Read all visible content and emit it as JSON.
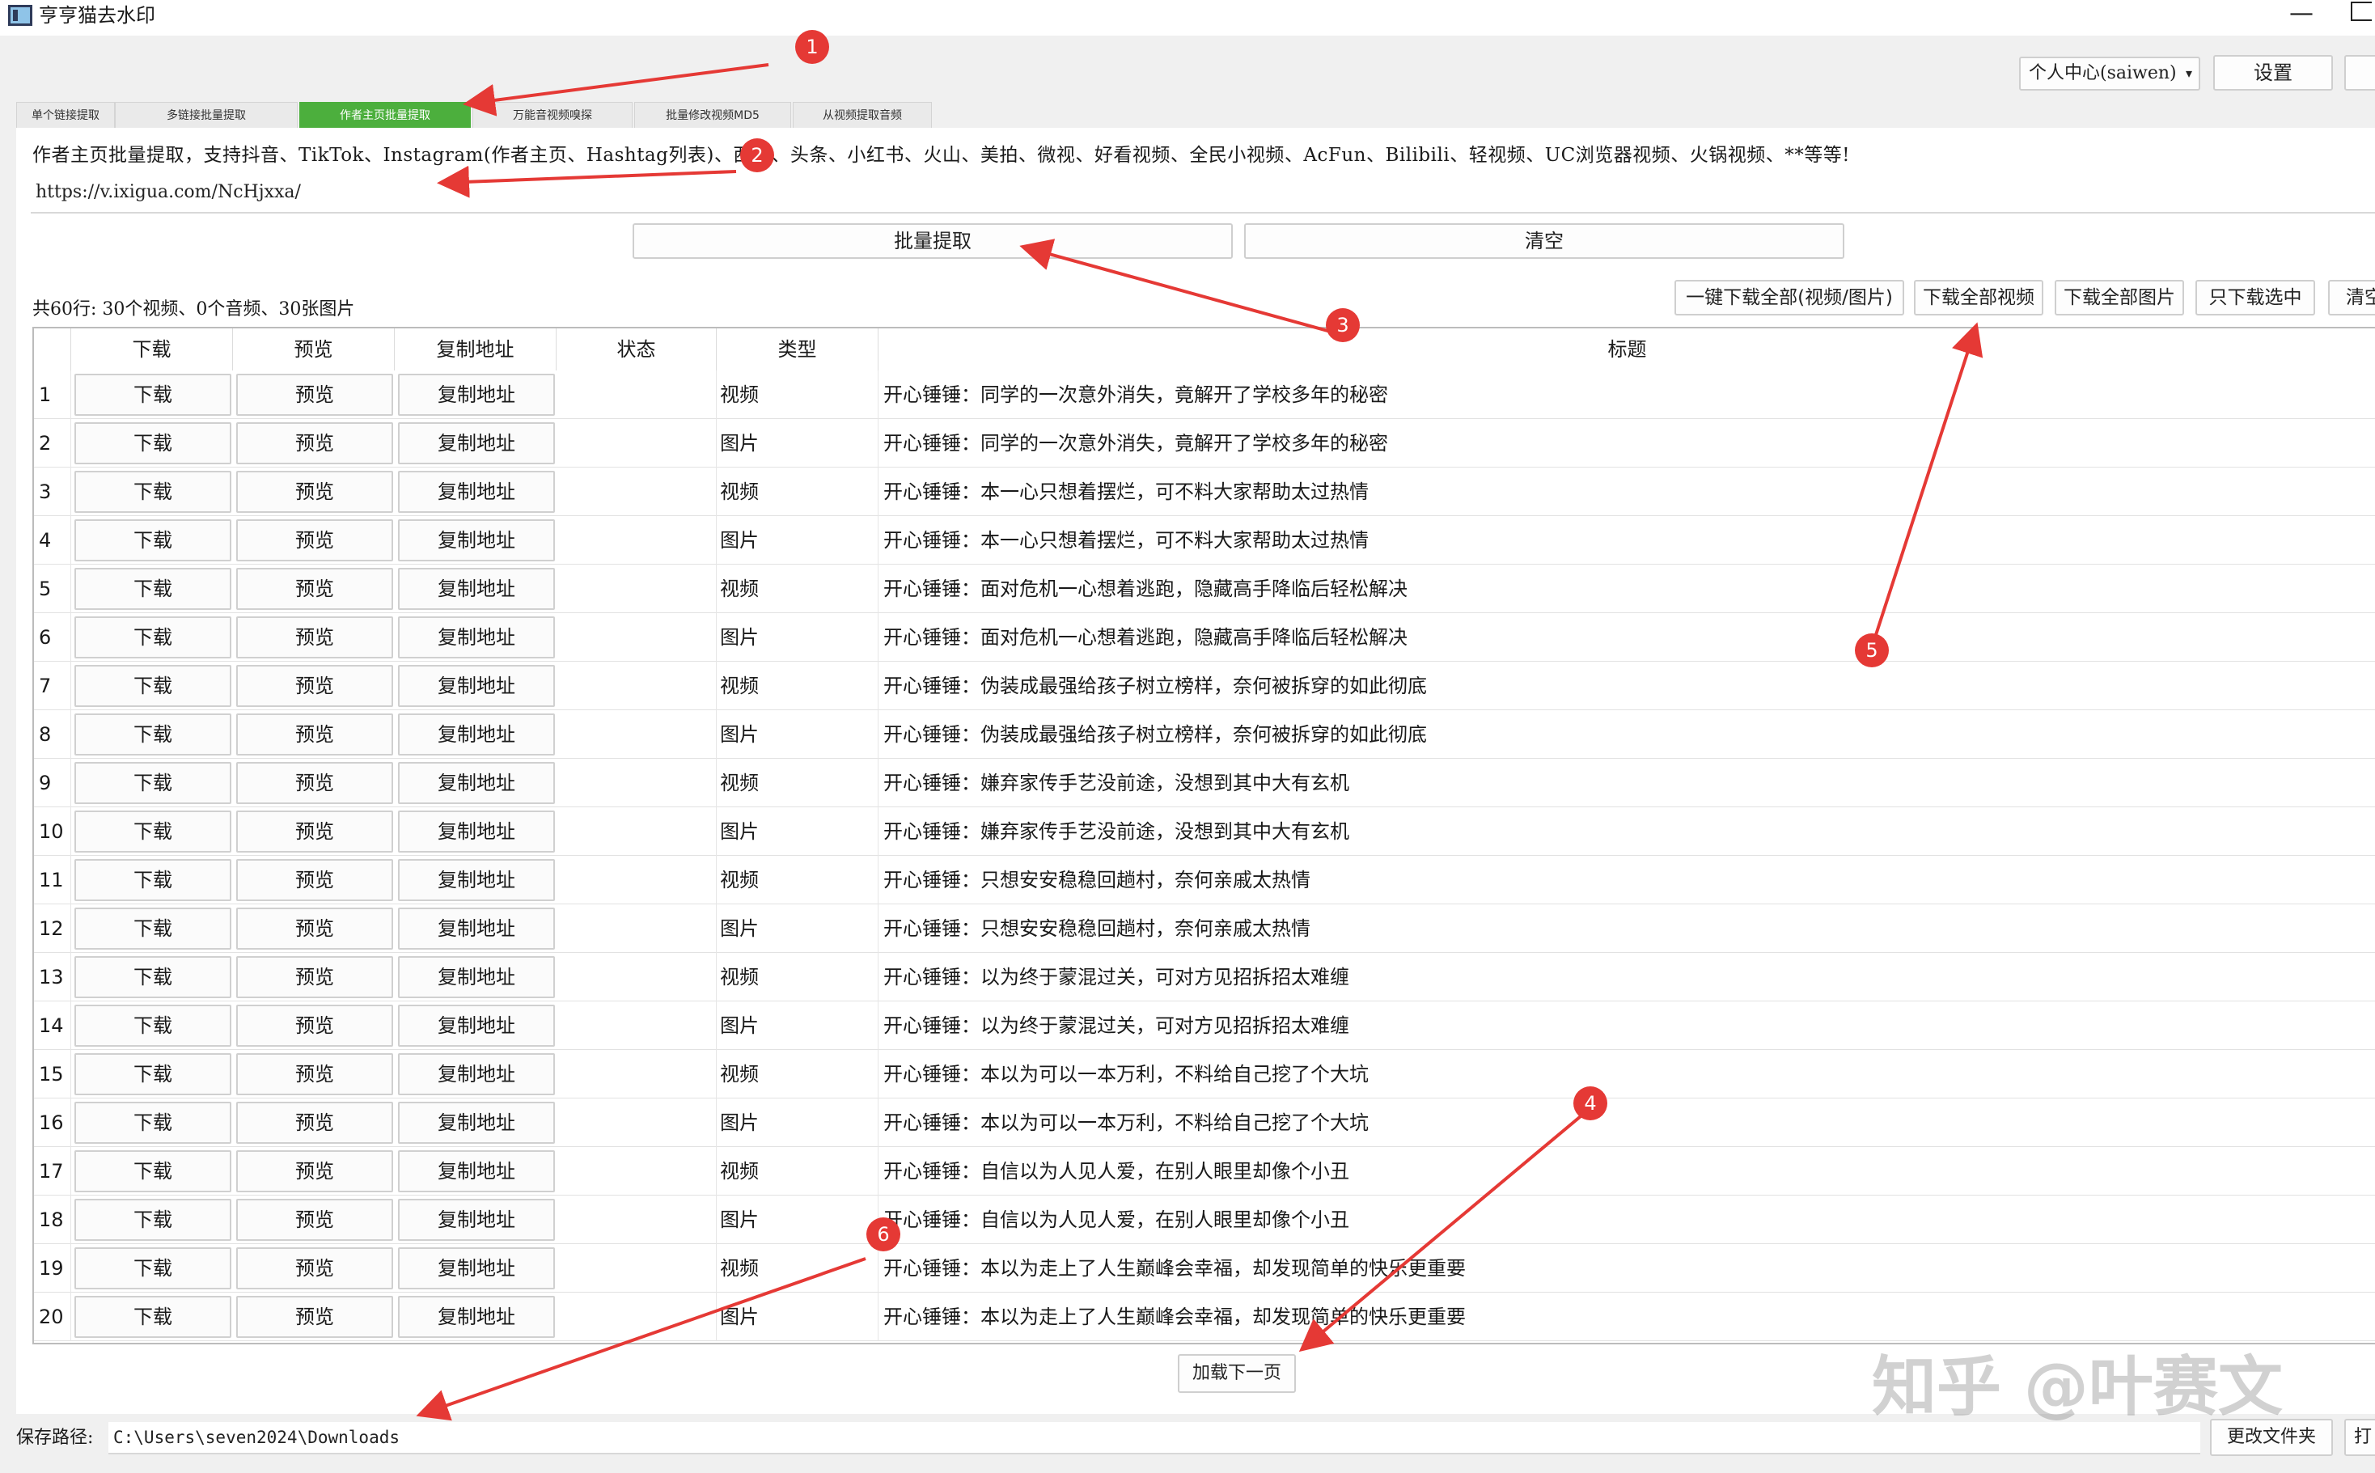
{
  "window": {
    "title": "亨亨猫去水印",
    "minimize": "—"
  },
  "header": {
    "user_select": "个人中心(saiwen)",
    "settings": "设置"
  },
  "tabs": [
    {
      "label": "单个链接提取",
      "active": false
    },
    {
      "label": "多链接批量提取",
      "active": false
    },
    {
      "label": "作者主页批量提取",
      "active": true
    },
    {
      "label": "万能音视频嗅探",
      "active": false
    },
    {
      "label": "批量修改视频MD5",
      "active": false
    },
    {
      "label": "从视频提取音频",
      "active": false
    }
  ],
  "main": {
    "description": "作者主页批量提取，支持抖音、TikTok、Instagram(作者主页、Hashtag列表)、西瓜、头条、小红书、火山、美拍、微视、好看视频、全民小视频、AcFun、Bilibili、轻视频、UC浏览器视频、火锅视频、**等等!",
    "url_value": "https://v.ixigua.com/NcHjxxa/",
    "batch_button": "批量提取",
    "clear_button": "清空",
    "stats": "共60行: 30个视频、0个音频、30张图片",
    "actions": [
      "一键下载全部(视频/图片)",
      "下载全部视频",
      "下载全部图片",
      "只下载选中",
      "清空"
    ]
  },
  "table": {
    "columns": [
      "",
      "下载",
      "预览",
      "复制地址",
      "状态",
      "类型",
      "标题"
    ],
    "download_label": "下载",
    "preview_label": "预览",
    "copy_label": "复制地址",
    "rows": [
      {
        "n": "1",
        "type": "视频",
        "title": "开心锤锤：同学的一次意外消失，竟解开了学校多年的秘密"
      },
      {
        "n": "2",
        "type": "图片",
        "title": "开心锤锤：同学的一次意外消失，竟解开了学校多年的秘密"
      },
      {
        "n": "3",
        "type": "视频",
        "title": "开心锤锤：本一心只想着摆烂，可不料大家帮助太过热情"
      },
      {
        "n": "4",
        "type": "图片",
        "title": "开心锤锤：本一心只想着摆烂，可不料大家帮助太过热情"
      },
      {
        "n": "5",
        "type": "视频",
        "title": "开心锤锤：面对危机一心想着逃跑，隐藏高手降临后轻松解决"
      },
      {
        "n": "6",
        "type": "图片",
        "title": "开心锤锤：面对危机一心想着逃跑，隐藏高手降临后轻松解决"
      },
      {
        "n": "7",
        "type": "视频",
        "title": "开心锤锤：伪装成最强给孩子树立榜样，奈何被拆穿的如此彻底"
      },
      {
        "n": "8",
        "type": "图片",
        "title": "开心锤锤：伪装成最强给孩子树立榜样，奈何被拆穿的如此彻底"
      },
      {
        "n": "9",
        "type": "视频",
        "title": "开心锤锤：嫌弃家传手艺没前途，没想到其中大有玄机"
      },
      {
        "n": "10",
        "type": "图片",
        "title": "开心锤锤：嫌弃家传手艺没前途，没想到其中大有玄机"
      },
      {
        "n": "11",
        "type": "视频",
        "title": "开心锤锤：只想安安稳稳回趟村，奈何亲戚太热情"
      },
      {
        "n": "12",
        "type": "图片",
        "title": "开心锤锤：只想安安稳稳回趟村，奈何亲戚太热情"
      },
      {
        "n": "13",
        "type": "视频",
        "title": "开心锤锤：以为终于蒙混过关，可对方见招拆招太难缠"
      },
      {
        "n": "14",
        "type": "图片",
        "title": "开心锤锤：以为终于蒙混过关，可对方见招拆招太难缠"
      },
      {
        "n": "15",
        "type": "视频",
        "title": "开心锤锤：本以为可以一本万利，不料给自己挖了个大坑"
      },
      {
        "n": "16",
        "type": "图片",
        "title": "开心锤锤：本以为可以一本万利，不料给自己挖了个大坑"
      },
      {
        "n": "17",
        "type": "视频",
        "title": "开心锤锤：自信以为人见人爱，在别人眼里却像个小丑"
      },
      {
        "n": "18",
        "type": "图片",
        "title": "开心锤锤：自信以为人见人爱，在别人眼里却像个小丑"
      },
      {
        "n": "19",
        "type": "视频",
        "title": "开心锤锤：本以为走上了人生巅峰会幸福，却发现简单的快乐更重要"
      },
      {
        "n": "20",
        "type": "图片",
        "title": "开心锤锤：本以为走上了人生巅峰会幸福，却发现简单的快乐更重要"
      }
    ],
    "load_more": "加载下一页"
  },
  "footer": {
    "save_label": "保存路径:",
    "save_path": "C:\\Users\\seven2024\\Downloads",
    "change_folder": "更改文件夹",
    "open_folder": "打"
  },
  "annotations": [
    "1",
    "2",
    "3",
    "4",
    "5",
    "6"
  ],
  "watermark": "知乎 @叶赛文",
  "colors": {
    "active_tab": "#4caf3d",
    "marker": "#e53935"
  }
}
